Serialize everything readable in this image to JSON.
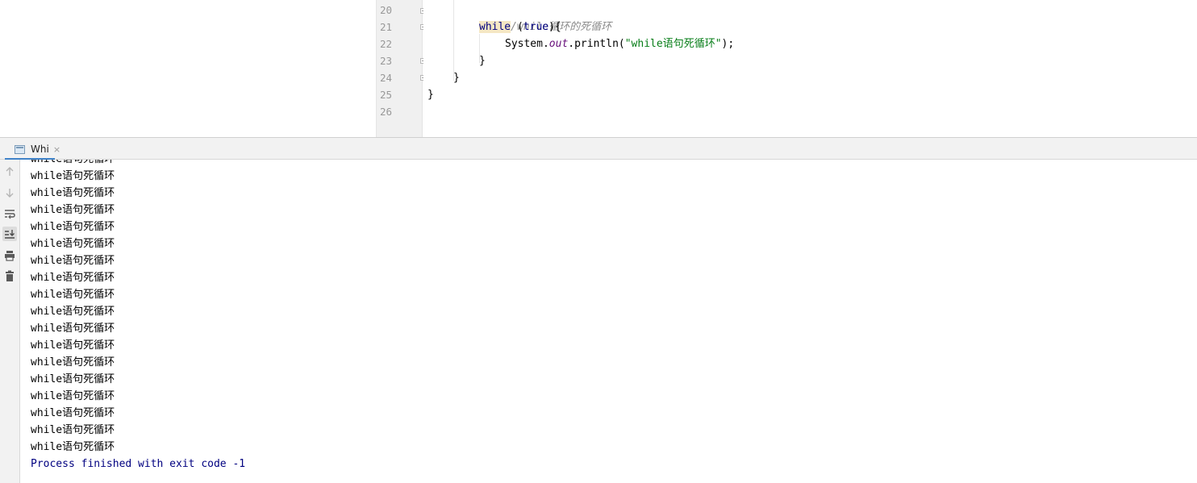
{
  "editor": {
    "line_numbers": [
      "20",
      "21",
      "22",
      "23",
      "24",
      "25",
      "26"
    ],
    "code": {
      "comment": "//while循环的死循环",
      "while_kw": "while",
      "while_rest_open": " (",
      "true_kw": "true",
      "while_rest_close": "){",
      "system": "System.",
      "out": "out",
      "println_open": ".println(",
      "string": "\"while语句死循环\"",
      "println_close": ");",
      "brace_inner": "}",
      "brace_method": "}",
      "brace_class": "}"
    }
  },
  "run_panel": {
    "tab_label": "Whi",
    "tab_close": "×",
    "output_lines": [
      "while语句死循环",
      "while语句死循环",
      "while语句死循环",
      "while语句死循环",
      "while语句死循环",
      "while语句死循环",
      "while语句死循环",
      "while语句死循环",
      "while语句死循环",
      "while语句死循环",
      "while语句死循环",
      "while语句死循环",
      "while语句死循环",
      "while语句死循环",
      "while语句死循环",
      "while语句死循环",
      "while语句死循环",
      "while语句死循环"
    ],
    "process_message": "Process finished with exit code -1",
    "toolbar_icons": [
      "arrow-up-icon",
      "arrow-down-icon",
      "soft-wrap-icon",
      "scroll-to-end-icon",
      "print-icon",
      "trash-icon"
    ]
  }
}
